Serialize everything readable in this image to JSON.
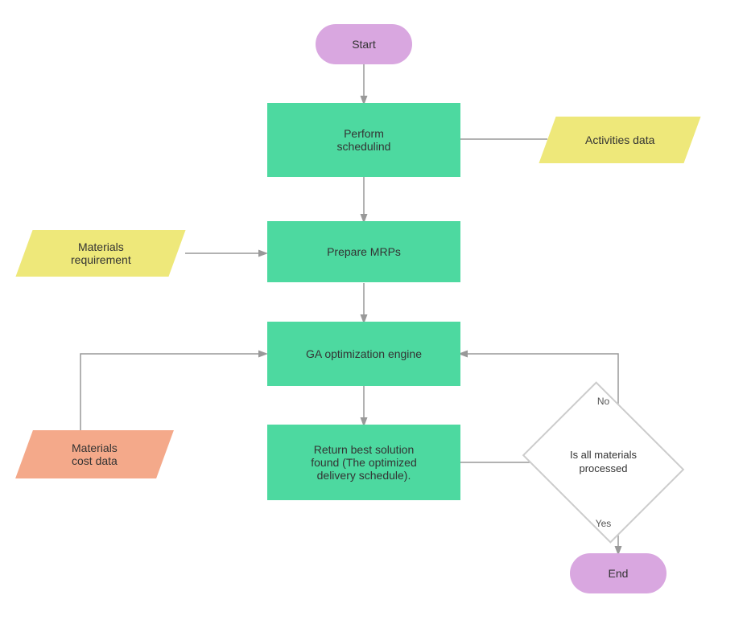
{
  "nodes": {
    "start": {
      "label": "Start"
    },
    "perform": {
      "label": "Perform\nschedulind"
    },
    "activities": {
      "label": "Activities data"
    },
    "prepare": {
      "label": "Prepare MRPs"
    },
    "materials_req": {
      "label": "Materials\nrequirement"
    },
    "ga": {
      "label": "GA optimization engine"
    },
    "return": {
      "label": "Return best solution\nfound (The optimized\ndelivery schedule)."
    },
    "materials_cost": {
      "label": "Materials\ncost data"
    },
    "diamond": {
      "label": "Is all materials\nprocessed"
    },
    "end": {
      "label": "End"
    }
  },
  "labels": {
    "no": "No",
    "yes": "Yes"
  }
}
